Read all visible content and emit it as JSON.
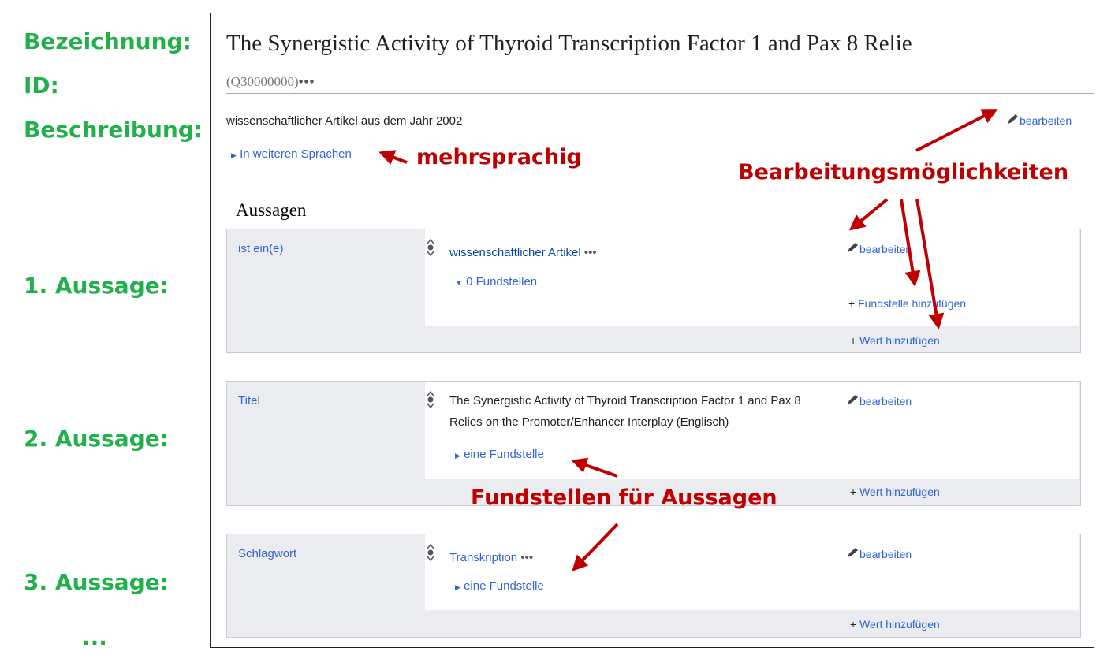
{
  "left_labels": {
    "label": "Bezeichnung:",
    "id": "ID:",
    "description": "Beschreibung:",
    "statement1": "1. Aussage:",
    "statement2": "2. Aussage:",
    "statement3": "3. Aussage:",
    "more": "..."
  },
  "item": {
    "title": "The Synergistic Activity of Thyroid Transcription Factor 1 and Pax 8 Relie",
    "qid": "(Q30000000)",
    "qid_more": "•••",
    "description": "wissenschaftlicher Artikel aus dem Jahr 2002",
    "edit_label": "bearbeiten",
    "languages_link": "In weiteren Sprachen"
  },
  "section_title": "Aussagen",
  "statements": [
    {
      "property": "ist ein(e)",
      "value": "wissenschaftlicher Artikel",
      "value_more": "•••",
      "references": "0 Fundstellen",
      "edit": "bearbeiten",
      "add_reference": "Fundstelle hinzufügen",
      "add_value": "Wert hinzufügen"
    },
    {
      "property": "Titel",
      "value": "The Synergistic Activity of Thyroid Transcription Factor 1 and Pax 8 Relies on the Promoter/Enhancer Interplay (Englisch)",
      "references": "eine Fundstelle",
      "edit": "bearbeiten",
      "add_value": "Wert hinzufügen"
    },
    {
      "property": "Schlagwort",
      "value": "Transkription",
      "value_more": "•••",
      "references": "eine Fundstelle",
      "edit": "bearbeiten",
      "add_value": "Wert hinzufügen"
    }
  ],
  "annotations": {
    "multilingual": "mehrsprachig",
    "edit_options": "Bearbeitungsmöglichkeiten",
    "references_for_statements": "Fundstellen für Aussagen"
  },
  "icons": {
    "edit": "pencil-icon",
    "rank": "rank-selector-icon",
    "expand": "triangle-right-icon",
    "collapse": "triangle-down-icon",
    "add": "plus-icon"
  },
  "colors": {
    "label_green": "#21b04b",
    "annotation_red": "#c00000",
    "link_blue": "#3366cc",
    "statement_bg": "#eaecf0"
  }
}
